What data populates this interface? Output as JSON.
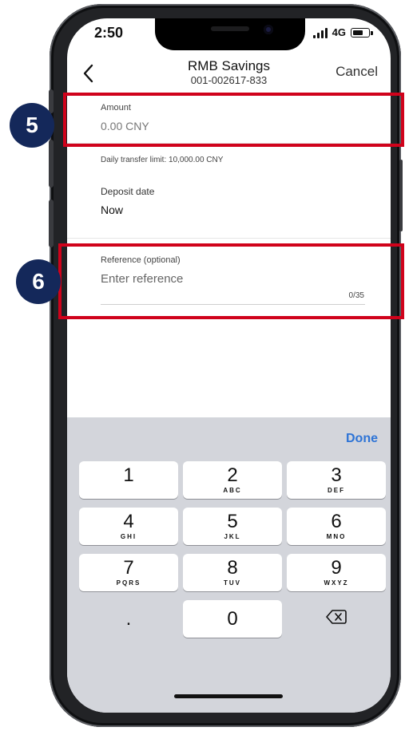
{
  "status_bar": {
    "time": "2:50",
    "network": "4G",
    "icons": [
      "cellular-signal-icon",
      "battery-icon"
    ]
  },
  "header": {
    "title": "RMB Savings",
    "account_number": "001-002617-833",
    "back_icon": "chevron-left-icon",
    "cancel_label": "Cancel"
  },
  "form": {
    "amount": {
      "label": "Amount",
      "placeholder": "0.00 CNY",
      "value": ""
    },
    "daily_limit_text": "Daily transfer limit: 10,000.00 CNY",
    "deposit_date": {
      "label": "Deposit date",
      "value": "Now"
    },
    "reference": {
      "label": "Reference (optional)",
      "placeholder": "Enter reference",
      "value": "",
      "counter": "0/35"
    }
  },
  "keyboard": {
    "done_label": "Done",
    "keys": [
      {
        "digit": "1",
        "letters": ""
      },
      {
        "digit": "2",
        "letters": "ABC"
      },
      {
        "digit": "3",
        "letters": "DEF"
      },
      {
        "digit": "4",
        "letters": "GHI"
      },
      {
        "digit": "5",
        "letters": "JKL"
      },
      {
        "digit": "6",
        "letters": "MNO"
      },
      {
        "digit": "7",
        "letters": "PQRS"
      },
      {
        "digit": "8",
        "letters": "TUV"
      },
      {
        "digit": "9",
        "letters": "WXYZ"
      }
    ],
    "dot_key": ".",
    "zero_key": "0",
    "backspace_icon": "backspace-icon"
  },
  "annotations": [
    {
      "number": "5",
      "color": "#d0021b",
      "badge_color": "#14285a"
    },
    {
      "number": "6",
      "color": "#d0021b",
      "badge_color": "#14285a"
    }
  ]
}
